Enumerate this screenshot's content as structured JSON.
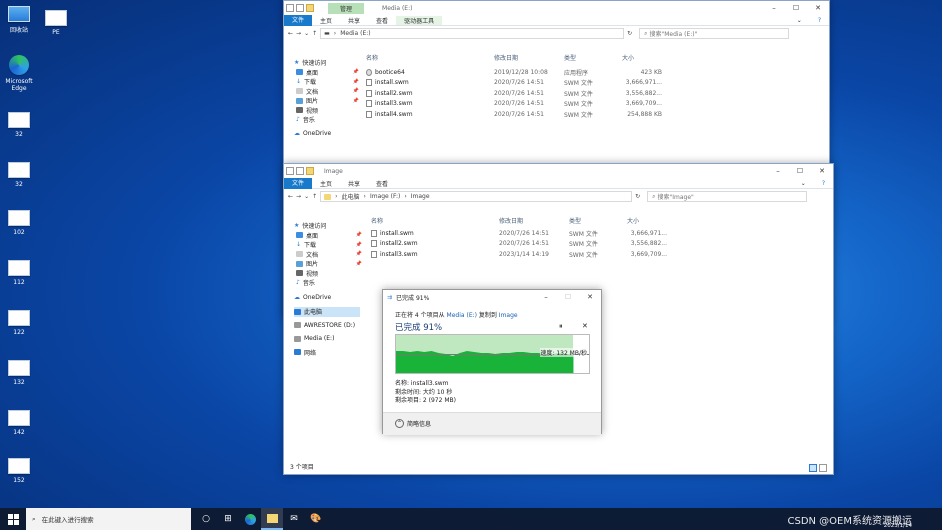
{
  "desktop": {
    "icons": [
      {
        "label": "回收站",
        "kind": "bin"
      },
      {
        "label": "Microsoft Edge",
        "kind": "edge"
      },
      {
        "label": "32",
        "kind": "file"
      },
      {
        "label": "32",
        "kind": "file"
      },
      {
        "label": "102",
        "kind": "file"
      },
      {
        "label": "112",
        "kind": "file"
      },
      {
        "label": "122",
        "kind": "file"
      },
      {
        "label": "132",
        "kind": "file"
      },
      {
        "label": "142",
        "kind": "file"
      },
      {
        "label": "152",
        "kind": "file"
      }
    ],
    "pc_icon_label": "PE"
  },
  "win1": {
    "ctx_tab": "管理",
    "title": "Media (E:)",
    "tabs": {
      "file": "文件",
      "home": "主页",
      "share": "共享",
      "view": "查看",
      "tools": "驱动器工具"
    },
    "address": "Media (E:)",
    "search": "搜索\"Media (E:)\"",
    "nav": {
      "quick": "快速访问",
      "desktop": "桌面",
      "downloads": "下载",
      "docs": "文档",
      "pics": "图片",
      "videos": "视频",
      "music": "音乐",
      "onedrive": "OneDrive"
    },
    "cols": {
      "name": "名称",
      "date": "修改日期",
      "type": "类型",
      "size": "大小"
    },
    "files": [
      {
        "name": "bootice64",
        "date": "2019/12/28 10:08",
        "type": "应用程序",
        "size": "423 KB"
      },
      {
        "name": "install.swm",
        "date": "2020/7/26 14:51",
        "type": "SWM 文件",
        "size": "3,666,971..."
      },
      {
        "name": "install2.swm",
        "date": "2020/7/26 14:51",
        "type": "SWM 文件",
        "size": "3,556,882..."
      },
      {
        "name": "install3.swm",
        "date": "2020/7/26 14:51",
        "type": "SWM 文件",
        "size": "3,669,709..."
      },
      {
        "name": "install4.swm",
        "date": "2020/7/26 14:51",
        "type": "SWM 文件",
        "size": "254,888 KB"
      }
    ]
  },
  "win2": {
    "title": "Image",
    "tabs": {
      "file": "文件",
      "home": "主页",
      "share": "共享",
      "view": "查看"
    },
    "address": {
      "p1": "此电脑",
      "p2": "Image (F:)",
      "p3": "Image"
    },
    "search": "搜索\"Image\"",
    "nav": {
      "quick": "快速访问",
      "desktop": "桌面",
      "downloads": "下载",
      "docs": "文档",
      "pics": "图片",
      "videos": "视频",
      "music": "音乐",
      "onedrive": "OneDrive",
      "thispc": "此电脑",
      "awre": "AWRESTORE (D:)",
      "media": "Media (E:)",
      "network": "网络"
    },
    "cols": {
      "name": "名称",
      "date": "修改日期",
      "type": "类型",
      "size": "大小"
    },
    "files": [
      {
        "name": "install.swm",
        "date": "2020/7/26 14:51",
        "type": "SWM 文件",
        "size": "3,666,971..."
      },
      {
        "name": "install2.swm",
        "date": "2020/7/26 14:51",
        "type": "SWM 文件",
        "size": "3,556,882..."
      },
      {
        "name": "install3.swm",
        "date": "2023/1/14 14:19",
        "type": "SWM 文件",
        "size": "3,669,709..."
      }
    ],
    "status": "3 个项目"
  },
  "copy": {
    "title": "已完成 91%",
    "line_prefix": "正在将 4 个项目从 ",
    "src": "Media (E:)",
    "mid": " 复制到 ",
    "dst": "Image",
    "pct": "已完成 91%",
    "progress": 0.91,
    "speed": "速度: 132 MB/秒",
    "name": "名称: install3.swm",
    "remaining_time": "剩余时间: 大约 10 秒",
    "remaining_items": "剩余项目: 2 (972 MB)",
    "less": "简略信息"
  },
  "taskbar": {
    "search": "在此键入进行搜索",
    "watermark": "CSDN @OEM系统资源搬运",
    "date": "2023/1/14"
  }
}
